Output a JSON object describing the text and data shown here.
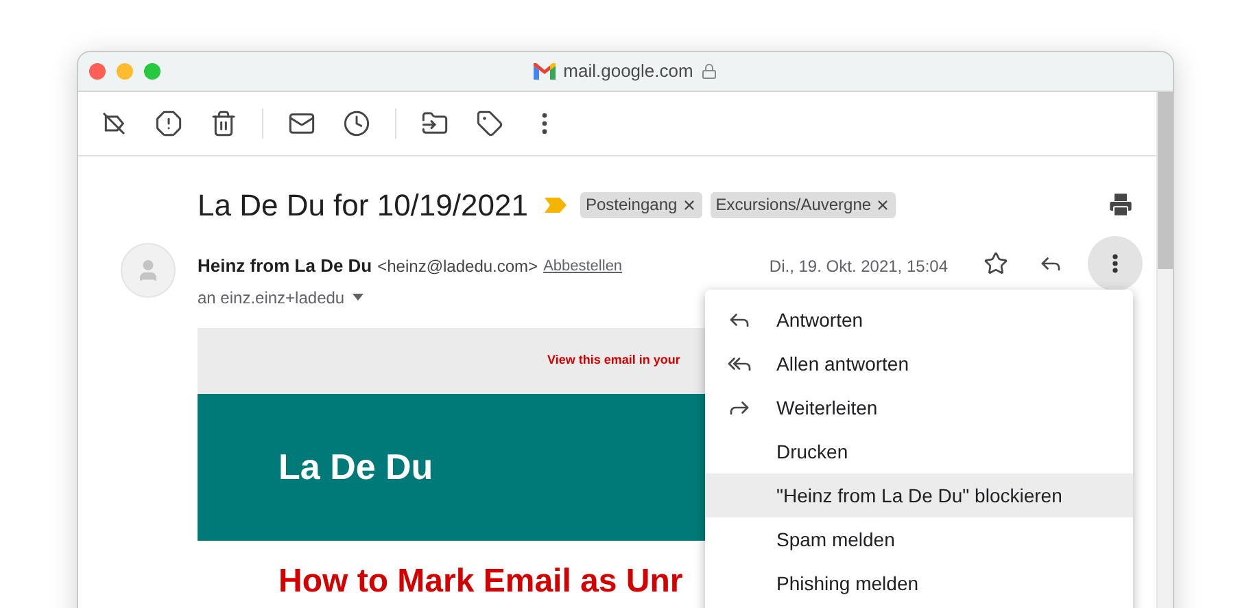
{
  "browser": {
    "address": "mail.google.com"
  },
  "message": {
    "subject": "La De Du for 10/19/2021",
    "important": true,
    "labels": [
      "Posteingang",
      "Excursions/Auvergne"
    ],
    "sender_name": "Heinz from La De Du",
    "sender_email": "<heinz@ladedu.com>",
    "unsubscribe": "Abbestellen",
    "date": "Di., 19. Okt. 2021, 15:04",
    "recipient": "an einz.einz+ladedu"
  },
  "body": {
    "view_link": "View this email in your",
    "banner_title": "La De Du",
    "heading": "How to Mark Email as Unr"
  },
  "menu": [
    {
      "label": "Antworten",
      "kind": "reply",
      "selected": false
    },
    {
      "label": "Allen antworten",
      "kind": "reply-all",
      "selected": false
    },
    {
      "label": "Weiterleiten",
      "kind": "forward",
      "selected": false
    },
    {
      "label": "Drucken",
      "kind": "plain",
      "selected": false
    },
    {
      "label": "\"Heinz from La De Du\" blockieren",
      "kind": "plain",
      "selected": true
    },
    {
      "label": "Spam melden",
      "kind": "plain",
      "selected": false
    },
    {
      "label": "Phishing melden",
      "kind": "plain",
      "selected": false
    }
  ]
}
